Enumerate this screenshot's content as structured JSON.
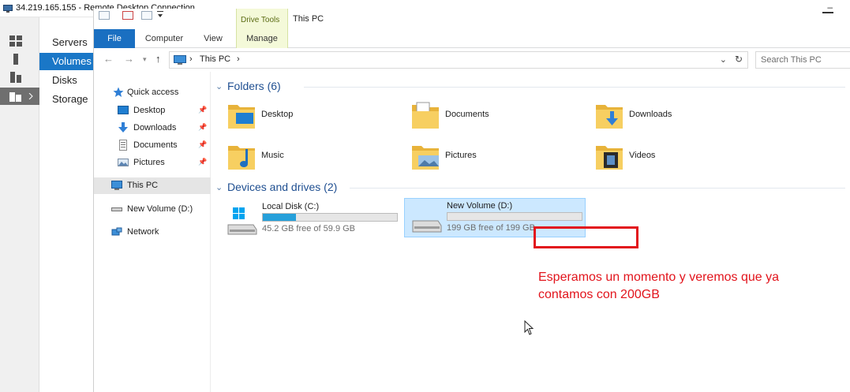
{
  "rdp": {
    "title": "34.219.165.155 - Remote Desktop Connection",
    "minimize": "–"
  },
  "server_manager": {
    "nav": [
      "Servers",
      "Volumes",
      "Disks",
      "Storage"
    ],
    "active": "Volumes"
  },
  "explorer": {
    "window_title": "This PC",
    "contextual_tab_group": "Drive Tools",
    "ribbon_tabs": [
      "File",
      "Computer",
      "View",
      "Manage"
    ],
    "address": {
      "crumbs": [
        "This PC"
      ],
      "separator": "›"
    },
    "search": {
      "placeholder": "Search This PC",
      "value": ""
    },
    "nav_pane": {
      "quick_access": "Quick access",
      "pinned": [
        {
          "label": "Desktop",
          "icon": "desktop-icon"
        },
        {
          "label": "Downloads",
          "icon": "download-arrow-icon"
        },
        {
          "label": "Documents",
          "icon": "document-icon"
        },
        {
          "label": "Pictures",
          "icon": "pictures-icon"
        }
      ],
      "this_pc": "This PC",
      "new_volume": "New Volume (D:)",
      "network": "Network"
    },
    "folders_group": "Folders (6)",
    "folders": [
      "Desktop",
      "Documents",
      "Downloads",
      "Music",
      "Pictures",
      "Videos"
    ],
    "drives_group": "Devices and drives (2)",
    "drives": [
      {
        "name": "Local Disk (C:)",
        "free_text": "45.2 GB free of 59.9 GB",
        "used_fraction": 0.245
      },
      {
        "name": "New Volume (D:)",
        "free_text": "199 GB free of 199 GB",
        "used_fraction": 0.0
      }
    ]
  },
  "annotation": {
    "caption_line1": "Esperamos un momento y veremos que ya",
    "caption_line2": "contamos con 200GB",
    "color": "#e2141c"
  },
  "colors": {
    "accent": "#1a6fc1",
    "selection": "#cce8ff",
    "drive_bar": "#26a0da",
    "folder": "#f4c552"
  }
}
